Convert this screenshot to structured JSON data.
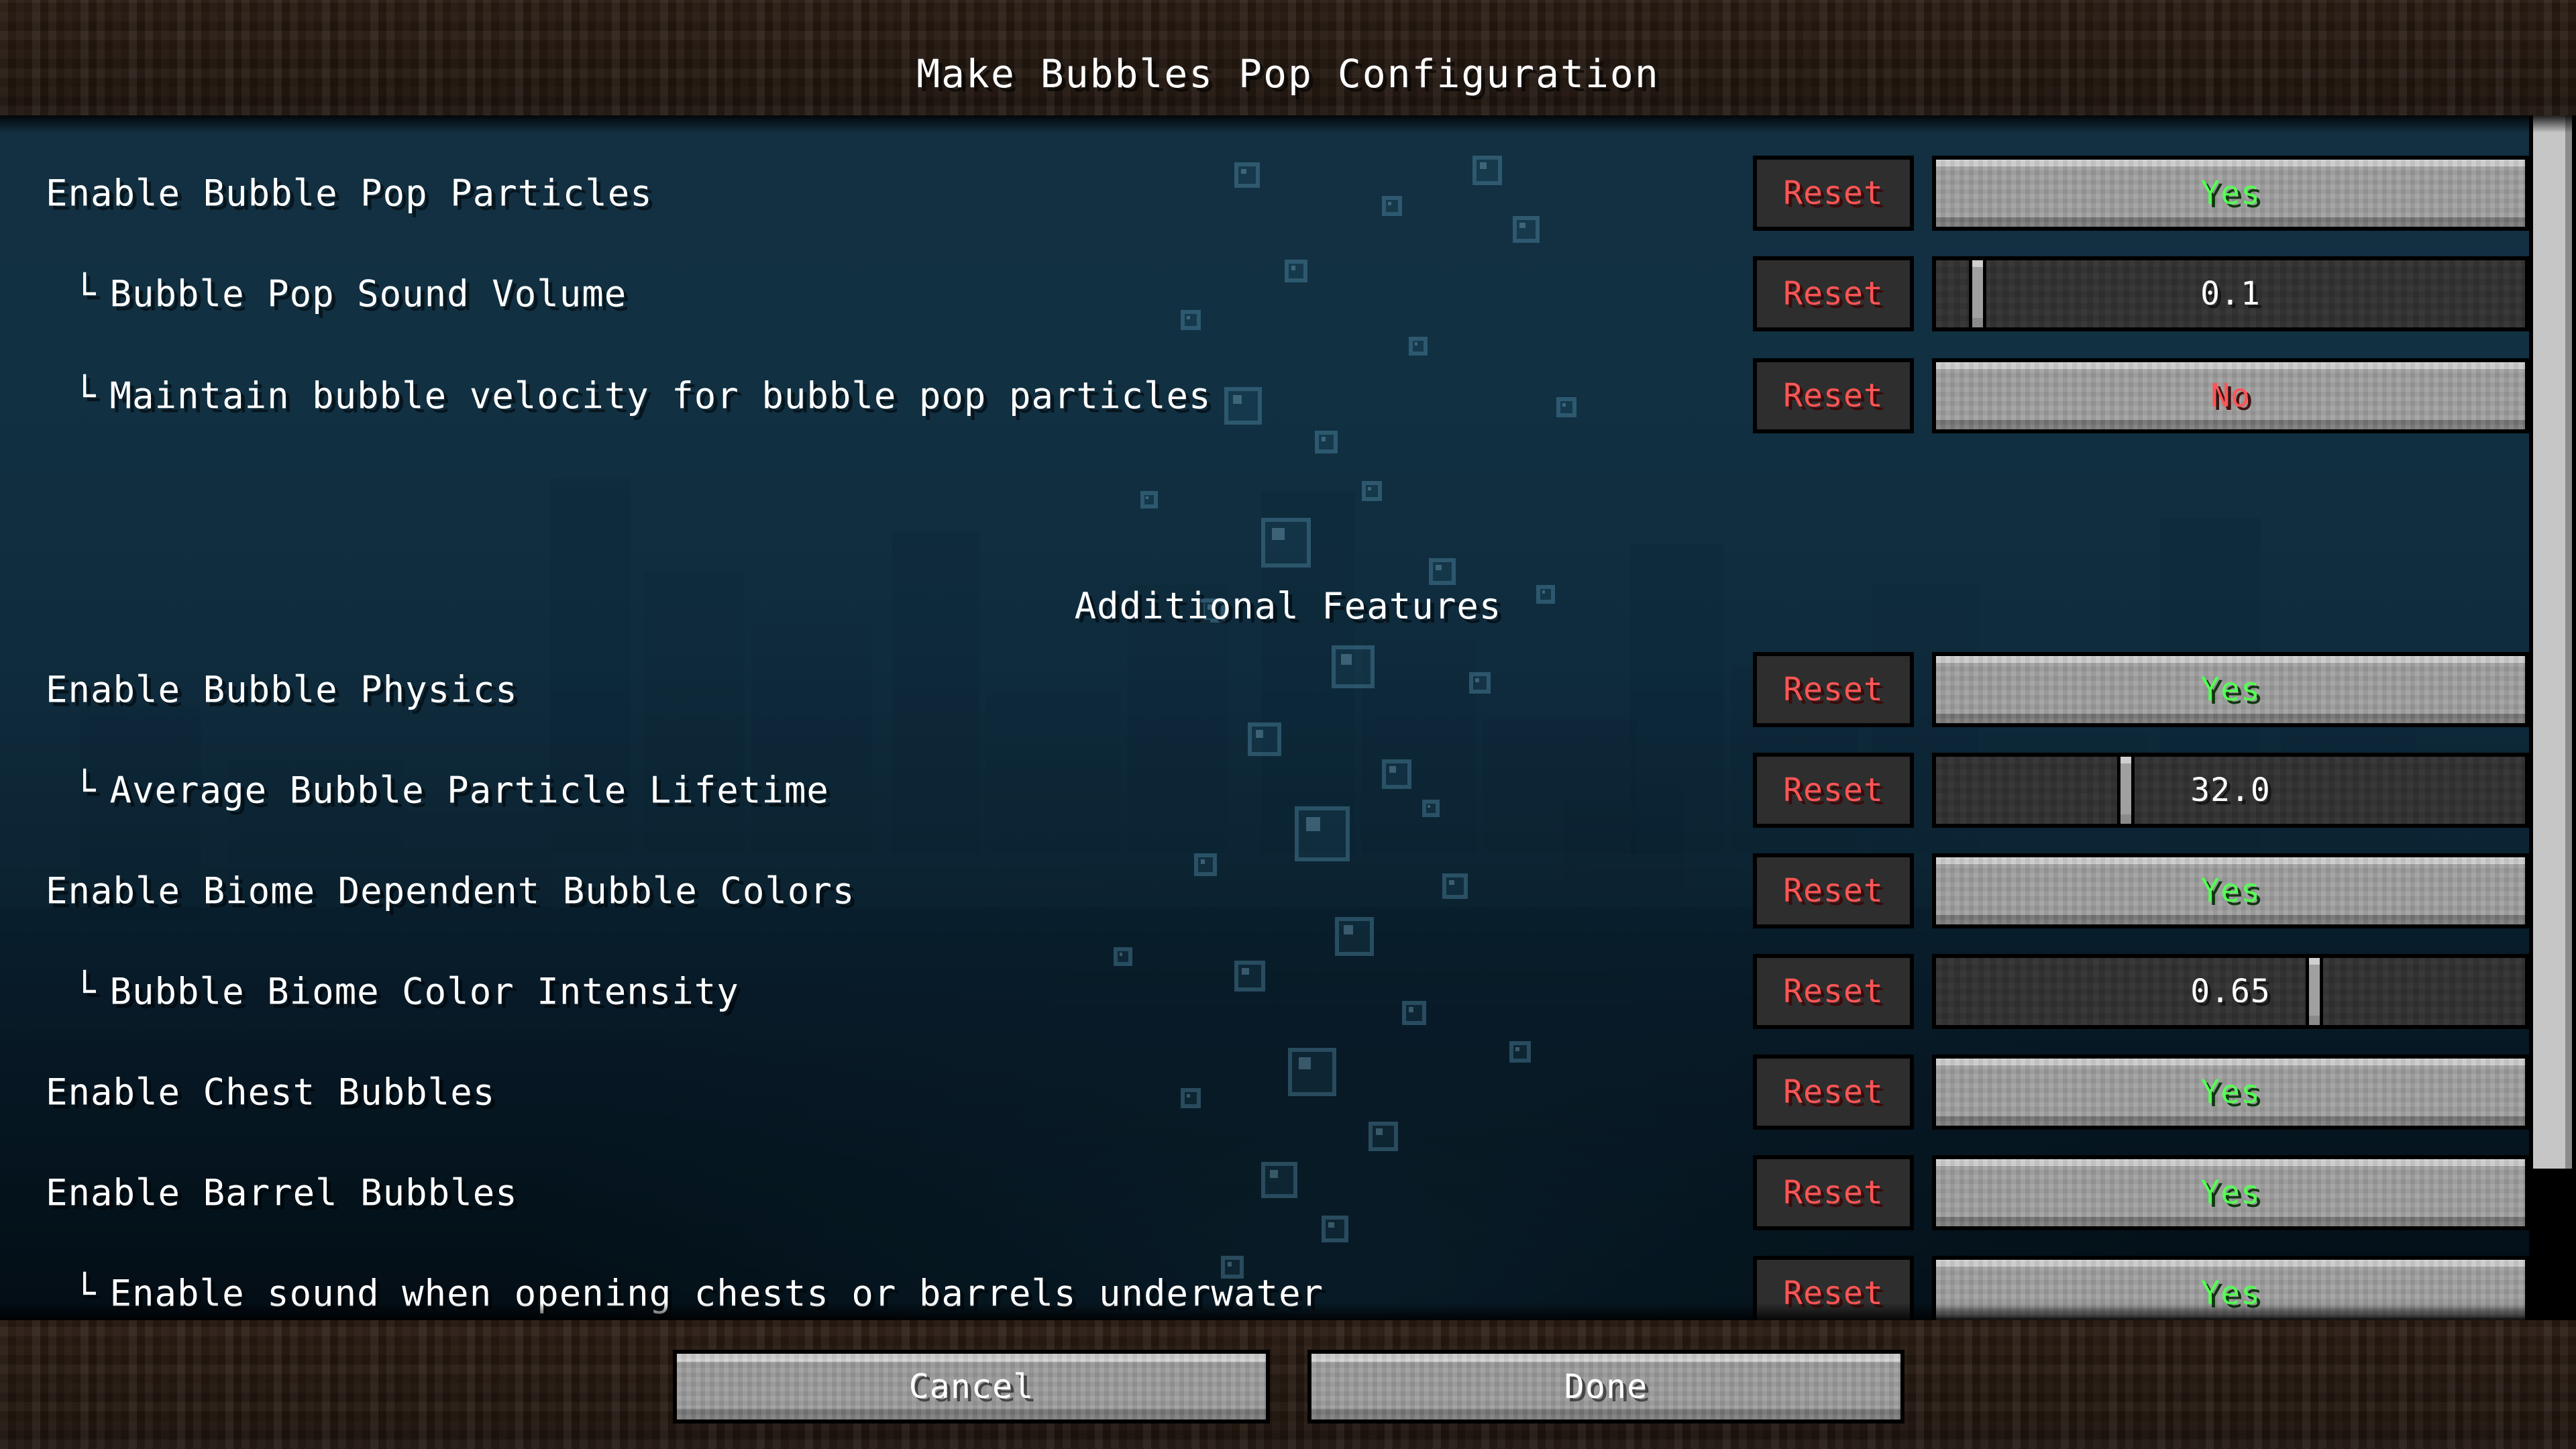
{
  "window": {
    "title": "Make Bubbles Pop Configuration"
  },
  "colors": {
    "yes": "#55FF55",
    "no": "#FF5555",
    "reset": "#FF5555",
    "label": "#FFFFFF",
    "button_face": "#9E9E9E",
    "slider_track": "#303030",
    "dirt": "#251A12",
    "water": "#123041"
  },
  "reset_label": "Reset",
  "rows": [
    {
      "label": "Enable Bubble Pop Particles",
      "sub": false,
      "reset": "Reset",
      "widget": "toggle",
      "value": "Yes",
      "state": "yes"
    },
    {
      "label": "Bubble Pop Sound Volume",
      "sub": true,
      "tree": "└",
      "reset": "Reset",
      "widget": "slider",
      "value": "0.1",
      "fill_percent": 5
    },
    {
      "label": "Maintain bubble velocity for bubble pop particles",
      "sub": true,
      "tree": "└",
      "reset": "Reset",
      "widget": "toggle",
      "value": "No",
      "state": "no"
    },
    {
      "label": "Enable Bubble Physics",
      "sub": false,
      "reset": "Reset",
      "widget": "toggle",
      "value": "Yes",
      "state": "yes"
    },
    {
      "label": "Average Bubble Particle Lifetime",
      "sub": true,
      "tree": "└",
      "reset": "Reset",
      "widget": "slider",
      "value": "32.0",
      "fill_percent": 31
    },
    {
      "label": "Enable Biome Dependent Bubble Colors",
      "sub": false,
      "reset": "Reset",
      "widget": "toggle",
      "value": "Yes",
      "state": "yes"
    },
    {
      "label": "Bubble Biome Color Intensity",
      "sub": true,
      "tree": "└",
      "reset": "Reset",
      "widget": "slider",
      "value": "0.65",
      "fill_percent": 64
    },
    {
      "label": "Enable Chest Bubbles",
      "sub": false,
      "reset": "Reset",
      "widget": "toggle",
      "value": "Yes",
      "state": "yes"
    },
    {
      "label": "Enable Barrel Bubbles",
      "sub": false,
      "reset": "Reset",
      "widget": "toggle",
      "value": "Yes",
      "state": "yes"
    },
    {
      "label": "Enable sound when opening chests or barrels underwater",
      "sub": true,
      "tree": "└",
      "reset": "Reset",
      "widget": "toggle",
      "value": "Yes",
      "state": "yes"
    }
  ],
  "section_header": {
    "label": "Additional Features"
  },
  "footer": {
    "cancel_label": "Cancel",
    "done_label": "Done"
  },
  "scrollbar": {
    "visible": true
  }
}
